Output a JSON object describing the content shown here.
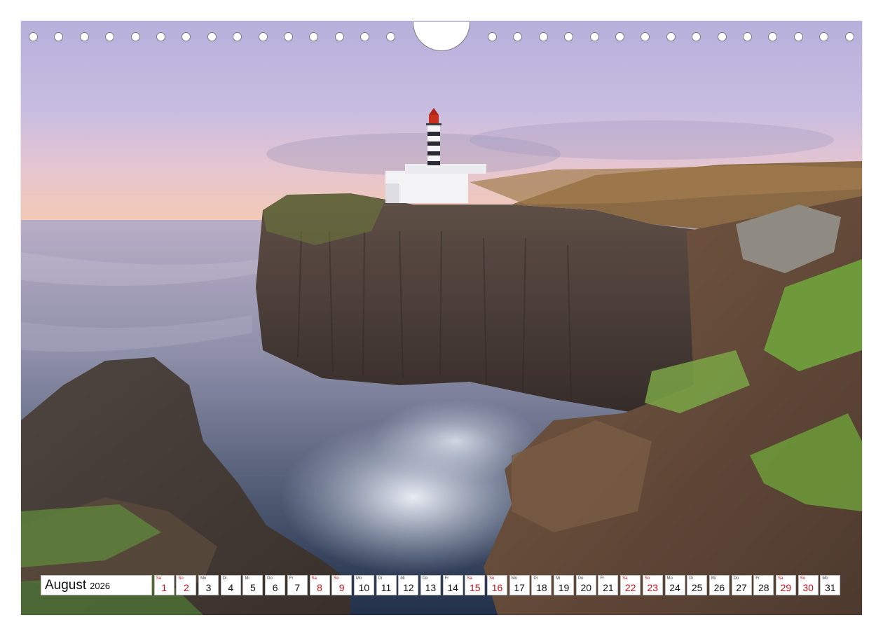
{
  "calendar": {
    "month": "August",
    "year": "2026",
    "days": [
      {
        "wd": "Sa",
        "day": "1",
        "weekend": true
      },
      {
        "wd": "So",
        "day": "2",
        "weekend": true
      },
      {
        "wd": "Mo",
        "day": "3",
        "weekend": false
      },
      {
        "wd": "Di",
        "day": "4",
        "weekend": false
      },
      {
        "wd": "Mi",
        "day": "5",
        "weekend": false
      },
      {
        "wd": "Do",
        "day": "6",
        "weekend": false
      },
      {
        "wd": "Fr",
        "day": "7",
        "weekend": false
      },
      {
        "wd": "Sa",
        "day": "8",
        "weekend": true
      },
      {
        "wd": "So",
        "day": "9",
        "weekend": true
      },
      {
        "wd": "Mo",
        "day": "10",
        "weekend": false
      },
      {
        "wd": "Di",
        "day": "11",
        "weekend": false
      },
      {
        "wd": "Mi",
        "day": "12",
        "weekend": false
      },
      {
        "wd": "Do",
        "day": "13",
        "weekend": false
      },
      {
        "wd": "Fr",
        "day": "14",
        "weekend": false
      },
      {
        "wd": "Sa",
        "day": "15",
        "weekend": true
      },
      {
        "wd": "So",
        "day": "16",
        "weekend": true
      },
      {
        "wd": "Mo",
        "day": "17",
        "weekend": false
      },
      {
        "wd": "Di",
        "day": "18",
        "weekend": false
      },
      {
        "wd": "Mi",
        "day": "19",
        "weekend": false
      },
      {
        "wd": "Do",
        "day": "20",
        "weekend": false
      },
      {
        "wd": "Fr",
        "day": "21",
        "weekend": false
      },
      {
        "wd": "Sa",
        "day": "22",
        "weekend": true
      },
      {
        "wd": "So",
        "day": "23",
        "weekend": true
      },
      {
        "wd": "Mo",
        "day": "24",
        "weekend": false
      },
      {
        "wd": "Di",
        "day": "25",
        "weekend": false
      },
      {
        "wd": "Mi",
        "day": "26",
        "weekend": false
      },
      {
        "wd": "Do",
        "day": "27",
        "weekend": false
      },
      {
        "wd": "Fr",
        "day": "28",
        "weekend": false
      },
      {
        "wd": "Sa",
        "day": "29",
        "weekend": true
      },
      {
        "wd": "So",
        "day": "30",
        "weekend": true
      },
      {
        "wd": "Mo",
        "day": "31",
        "weekend": false
      }
    ]
  },
  "colors": {
    "weekend": "#c4121b",
    "weekday": "#111111"
  }
}
